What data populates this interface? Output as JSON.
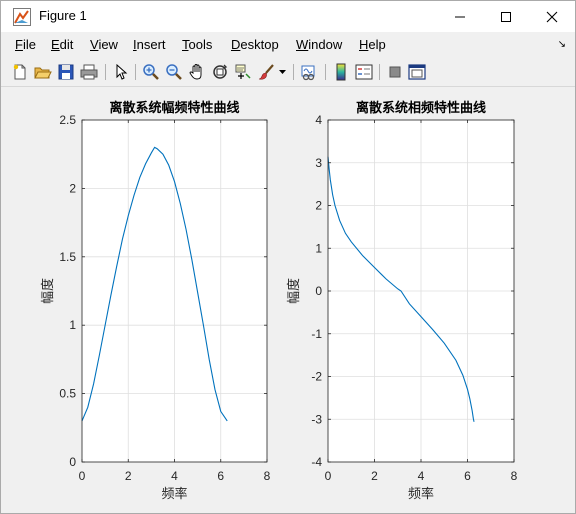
{
  "window": {
    "title": "Figure 1",
    "controls": [
      "minimize",
      "maximize",
      "close"
    ]
  },
  "menu": {
    "items": [
      {
        "label": "File",
        "u": "F",
        "rest": "ile"
      },
      {
        "label": "Edit",
        "u": "E",
        "rest": "dit"
      },
      {
        "label": "View",
        "u": "V",
        "rest": "iew"
      },
      {
        "label": "Insert",
        "u": "I",
        "rest": "nsert"
      },
      {
        "label": "Tools",
        "u": "T",
        "rest": "ools"
      },
      {
        "label": "Desktop",
        "u": "D",
        "rest": "esktop"
      },
      {
        "label": "Window",
        "u": "W",
        "rest": "indow"
      },
      {
        "label": "Help",
        "u": "H",
        "rest": "elp"
      }
    ],
    "arrow": "↘"
  },
  "toolbar": {
    "icons": [
      "new-figure-icon",
      "open-folder-icon",
      "save-icon",
      "print-icon",
      "pointer-icon",
      "zoom-in-icon",
      "zoom-out-icon",
      "pan-hand-icon",
      "rotate-3d-icon",
      "data-cursor-icon",
      "brush-icon",
      "brush-dropdown-icon",
      "link-plot-icon",
      "colorbar-icon",
      "legend-icon",
      "hide-plot-tools-icon",
      "show-plot-tools-icon"
    ]
  },
  "colors": {
    "line": "#0072BD",
    "grid": "#dfdfdf",
    "axes": "#262626"
  },
  "chart_data": [
    {
      "type": "line",
      "title": "离散系统幅频特性曲线",
      "xlabel": "频率",
      "ylabel": "幅度",
      "xlim": [
        0,
        8
      ],
      "ylim": [
        0,
        2.5
      ],
      "xticks": [
        0,
        2,
        4,
        6,
        8
      ],
      "yticks": [
        0,
        0.5,
        1,
        1.5,
        2,
        2.5
      ],
      "xtick_labels": [
        "0",
        "2",
        "4",
        "6",
        "8"
      ],
      "ytick_labels": [
        "0",
        "0.5",
        "1",
        "1.5",
        "2",
        "2.5"
      ],
      "grid": true,
      "series": [
        {
          "x": [
            0,
            0.25,
            0.5,
            0.75,
            1,
            1.25,
            1.5,
            1.75,
            2,
            2.25,
            2.5,
            2.75,
            3,
            3.14,
            3.25,
            3.5,
            3.75,
            4,
            4.25,
            4.5,
            4.75,
            5,
            5.25,
            5.5,
            5.75,
            6,
            6.28
          ],
          "y": [
            0.3,
            0.4,
            0.57,
            0.78,
            1.0,
            1.22,
            1.43,
            1.63,
            1.8,
            1.95,
            2.08,
            2.18,
            2.26,
            2.3,
            2.29,
            2.25,
            2.17,
            2.05,
            1.89,
            1.7,
            1.48,
            1.24,
            1.0,
            0.75,
            0.53,
            0.37,
            0.3
          ]
        }
      ]
    },
    {
      "type": "line",
      "title": "离散系统相频特性曲线",
      "xlabel": "频率",
      "ylabel": "幅度",
      "xlim": [
        0,
        8
      ],
      "ylim": [
        -4,
        4
      ],
      "xticks": [
        0,
        2,
        4,
        6,
        8
      ],
      "yticks": [
        -4,
        -3,
        -2,
        -1,
        0,
        1,
        2,
        3,
        4
      ],
      "xtick_labels": [
        "0",
        "2",
        "4",
        "6",
        "8"
      ],
      "ytick_labels": [
        "-4",
        "-3",
        "-2",
        "-1",
        "0",
        "1",
        "2",
        "3",
        "4"
      ],
      "grid": true,
      "series": [
        {
          "x": [
            0,
            0.05,
            0.1,
            0.2,
            0.3,
            0.5,
            0.75,
            1,
            1.5,
            2,
            2.5,
            3,
            3.14,
            3.5,
            4,
            4.5,
            5,
            5.5,
            5.8,
            6,
            6.1,
            6.2,
            6.25,
            6.28
          ],
          "y": [
            3.14,
            2.85,
            2.6,
            2.25,
            2.0,
            1.65,
            1.35,
            1.15,
            0.82,
            0.55,
            0.28,
            0.05,
            0.0,
            -0.3,
            -0.6,
            -0.9,
            -1.22,
            -1.62,
            -1.97,
            -2.3,
            -2.52,
            -2.8,
            -2.98,
            -3.06
          ]
        }
      ]
    }
  ]
}
